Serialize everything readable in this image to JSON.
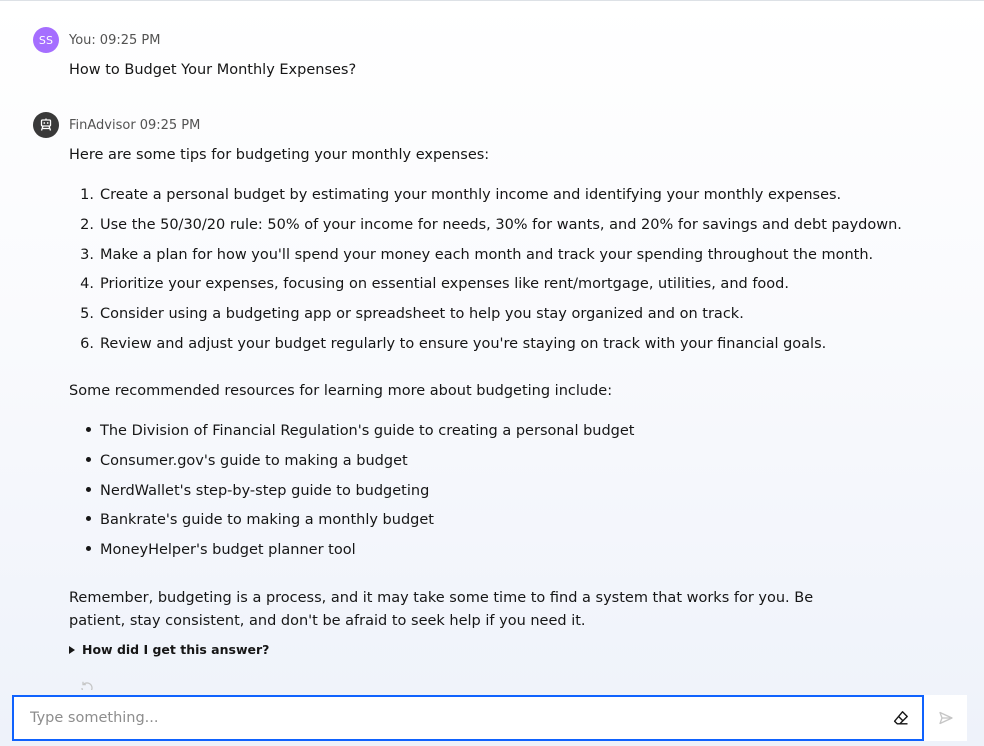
{
  "user_message": {
    "avatar_initials": "SS",
    "sender": "You:",
    "time": "09:25 PM",
    "text": "How to Budget Your Monthly Expenses?"
  },
  "bot_message": {
    "avatar_icon": "robot-icon",
    "sender": "FinAdvisor",
    "time": "09:25 PM",
    "intro": "Here are some tips for budgeting your monthly expenses:",
    "tips": [
      {
        "num": "1.",
        "text": "Create a personal budget by estimating your monthly income and identifying your monthly expenses."
      },
      {
        "num": "2.",
        "text": "Use the 50/30/20 rule: 50% of your income for needs, 30% for wants, and 20% for savings and debt paydown."
      },
      {
        "num": "3.",
        "text": "Make a plan for how you'll spend your money each month and track your spending throughout the month."
      },
      {
        "num": "4.",
        "text": "Prioritize your expenses, focusing on essential expenses like rent/mortgage, utilities, and food."
      },
      {
        "num": "5.",
        "text": "Consider using a budgeting app or spreadsheet to help you stay organized and on track."
      },
      {
        "num": "6.",
        "text": "Review and adjust your budget regularly to ensure you're staying on track with your financial goals."
      }
    ],
    "resources_intro": "Some recommended resources for learning more about budgeting include:",
    "resources": [
      "The Division of Financial Regulation's guide to creating a personal budget",
      "Consumer.gov's guide to making a budget",
      "NerdWallet's step-by-step guide to budgeting",
      "Bankrate's guide to making a monthly budget",
      "MoneyHelper's budget planner tool"
    ],
    "closing": "Remember, budgeting is a process, and it may take some time to find a system that works for you. Be patient, stay consistent, and don't be afraid to seek help if you need it.",
    "details_label": "How did I get this answer?"
  },
  "composer": {
    "placeholder": "Type something...",
    "value": "",
    "clear_icon": "eraser-icon",
    "send_icon": "send-icon"
  },
  "colors": {
    "accent": "#0f62fe",
    "user_avatar": "#a56eff",
    "bot_avatar": "#393939"
  }
}
